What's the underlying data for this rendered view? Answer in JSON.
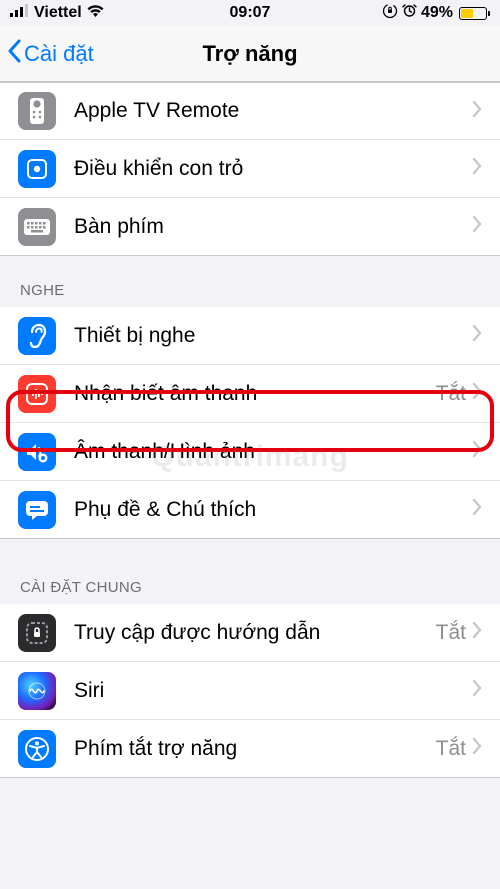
{
  "status": {
    "carrier": "Viettel",
    "time": "09:07",
    "battery_pct": "49%"
  },
  "nav": {
    "back_label": "Cài đặt",
    "title": "Trợ năng"
  },
  "section1": {
    "items": [
      {
        "label": "Apple TV Remote"
      },
      {
        "label": "Điều khiển con trỏ"
      },
      {
        "label": "Bàn phím"
      }
    ]
  },
  "section2": {
    "header": "NGHE",
    "items": [
      {
        "label": "Thiết bị nghe"
      },
      {
        "label": "Nhận biết âm thanh",
        "value": "Tắt"
      },
      {
        "label": "Âm thanh/Hình ảnh"
      },
      {
        "label": "Phụ đề & Chú thích"
      }
    ]
  },
  "section3": {
    "header": "CÀI ĐẶT CHUNG",
    "items": [
      {
        "label": "Truy cập được hướng dẫn",
        "value": "Tắt"
      },
      {
        "label": "Siri"
      },
      {
        "label": "Phím tắt trợ năng",
        "value": "Tắt"
      }
    ]
  },
  "watermark": "Quantrimang"
}
